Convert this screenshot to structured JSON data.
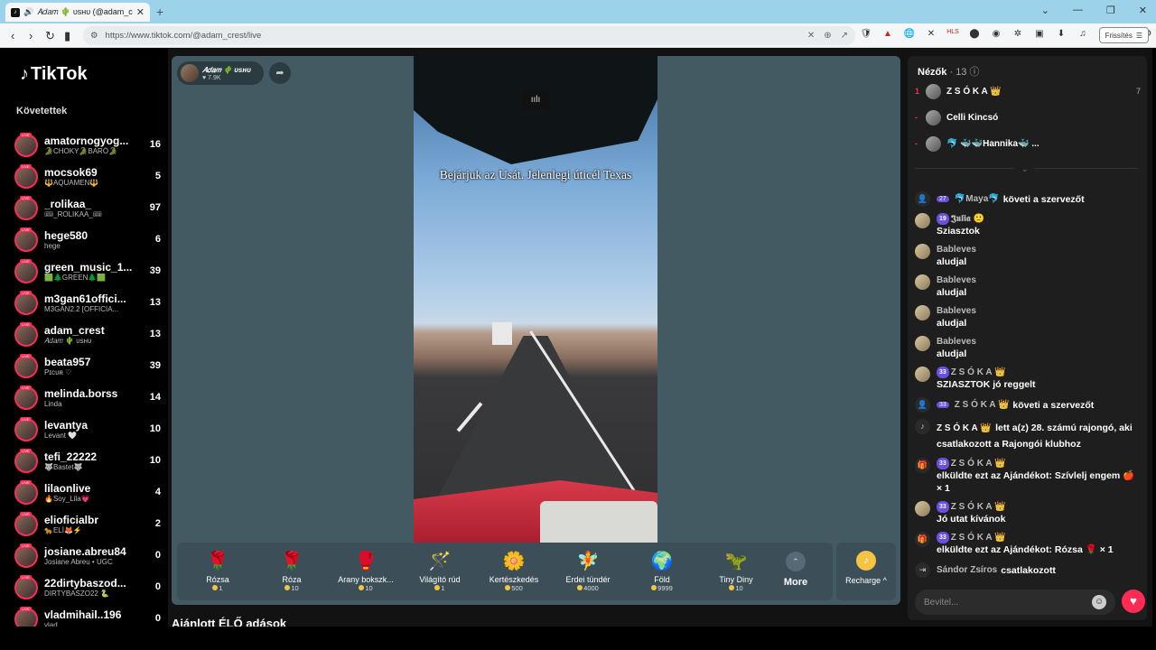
{
  "browser": {
    "tab_title": "𝐴𝑑𝑎𝑚 🌵 ᴜsʜᴜ (@adam_crest",
    "new_tab": "+",
    "url": "https://www.tiktok.com/@adam_crest/live",
    "refresh_label": "Frissítés",
    "extensions": [
      "🛡",
      "▲",
      "🌐",
      "✕",
      "HLS",
      "⬤",
      "🎨",
      "🧩",
      "▣",
      "⬇",
      "♫",
      "◨",
      "☆",
      "⚙",
      "🛡"
    ]
  },
  "sidebar": {
    "logo": "TikTok",
    "heading": "Követettek",
    "items": [
      {
        "name": "amatornogyog...",
        "sub": "🐊CHOKY🐊BARÓ🐊",
        "count": "16"
      },
      {
        "name": "mocsok69",
        "sub": "🔱AQUAMEN🔱",
        "count": "5"
      },
      {
        "name": "_rolikaa_",
        "sub": "🎟_ROLIKAA_🎟",
        "count": "97"
      },
      {
        "name": "hege580",
        "sub": "hege",
        "count": "6"
      },
      {
        "name": "green_music_1...",
        "sub": "🟩🌲GREEN🌲🟩",
        "count": "39"
      },
      {
        "name": "m3gan61offici...",
        "sub": "M3GAN2.2 [OFFICIA...",
        "count": "13"
      },
      {
        "name": "adam_crest",
        "sub": "𝐴𝑑𝑎𝑚 🌵 ᴜsʜᴜ",
        "count": "13"
      },
      {
        "name": "beata957",
        "sub": "Pɪcᴜʀ ♡",
        "count": "39"
      },
      {
        "name": "melinda.borss",
        "sub": "Linda",
        "count": "14"
      },
      {
        "name": "levantya",
        "sub": "Levant 🤍",
        "count": "10"
      },
      {
        "name": "tefi_22222",
        "sub": "🐺Bastet🐺",
        "count": "10"
      },
      {
        "name": "lilaonlive",
        "sub": "🔥Soy_Lila💗",
        "count": "4"
      },
      {
        "name": "elioficialbr",
        "sub": "🐆ELÍ🦊⚡",
        "count": "2"
      },
      {
        "name": "josiane.abreu84",
        "sub": "Josiane Abreu • UGC",
        "count": "0"
      },
      {
        "name": "22dirtybaszod...",
        "sub": "DIRTYBASZO22 🐍",
        "count": "0"
      },
      {
        "name": "vladmihail..196",
        "sub": "vlad",
        "count": "0"
      }
    ]
  },
  "stage": {
    "host_name": "𝐴𝑑𝑎𝑚 🌵 ᴜsʜᴜ",
    "host_likes": "♥ 7.9K",
    "caption": "Bejárjuk az Usát. Jelenlegi úticél Texas",
    "gifts": [
      {
        "icon": "🌹",
        "name": "Rózsa",
        "price": "1"
      },
      {
        "icon": "🌹",
        "name": "Róza",
        "price": "10"
      },
      {
        "icon": "🥊",
        "name": "Arany bokszk...",
        "price": "10"
      },
      {
        "icon": "🪄",
        "name": "Világító rúd",
        "price": "1"
      },
      {
        "icon": "🌼",
        "name": "Kertészkedés",
        "price": "500"
      },
      {
        "icon": "🧚",
        "name": "Erdei tündér",
        "price": "4000"
      },
      {
        "icon": "🌍",
        "name": "Föld",
        "price": "9999"
      },
      {
        "icon": "🦖",
        "name": "Tiny Diny",
        "price": "10"
      }
    ],
    "more_label": "More",
    "recharge_label": "Recharge ^",
    "recommended_title": "Ajánlott ÉLŐ adások"
  },
  "chat": {
    "viewers_label": "Nézők",
    "viewers_count": "· 13",
    "viewers": [
      {
        "rank": "1",
        "name": "Z S Ó K A 👑",
        "score": "7"
      },
      {
        "rank": "-",
        "name": "Celli Kincsó",
        "score": ""
      },
      {
        "rank": "-",
        "name": "🐬 🐳🐳Hannika🐳 ...",
        "score": ""
      }
    ],
    "messages": [
      {
        "kind": "follow",
        "badge": "27",
        "user": "🐬Maya🐬",
        "text": "követi a szervezőt"
      },
      {
        "kind": "chat",
        "badge": "19",
        "user": "𝕵𝖚𝖑𝖎𝖆 🙂",
        "text": "Sziasztok"
      },
      {
        "kind": "chat",
        "badge": "",
        "user": "Bableves",
        "text": "aludjal"
      },
      {
        "kind": "chat",
        "badge": "",
        "user": "Bableves",
        "text": "aludjal"
      },
      {
        "kind": "chat",
        "badge": "",
        "user": "Bableves",
        "text": "aludjal"
      },
      {
        "kind": "chat",
        "badge": "",
        "user": "Bableves",
        "text": "aludjal"
      },
      {
        "kind": "chat",
        "badge": "33",
        "user": "Z S Ó K A 👑",
        "text": "SZIASZTOK jó reggelt"
      },
      {
        "kind": "follow",
        "badge": "33",
        "user": "Z S Ó K A 👑",
        "text": "követi a szervezőt"
      },
      {
        "kind": "tiktok",
        "badge": "",
        "user": "Z S Ó K A 👑",
        "text": "lett a(z) 28. számú rajongó, aki csatlakozott a Rajongói klubhoz"
      },
      {
        "kind": "gift",
        "badge": "33",
        "user": "Z S Ó K A 👑",
        "text": "elküldte ezt az Ajándékot: Szívlelj engem 🍎 × 1"
      },
      {
        "kind": "chat",
        "badge": "33",
        "user": "Z S Ó K A 👑",
        "text": "Jó utat kívánok"
      },
      {
        "kind": "gift",
        "badge": "33",
        "user": "Z S Ó K A 👑",
        "text": "elküldte ezt az Ajándékot: Rózsa 🌹 × 1"
      },
      {
        "kind": "join",
        "badge": "",
        "user": "Sándor Zsíros",
        "text": "csatlakozott"
      }
    ],
    "input_placeholder": "Bevitel..."
  }
}
